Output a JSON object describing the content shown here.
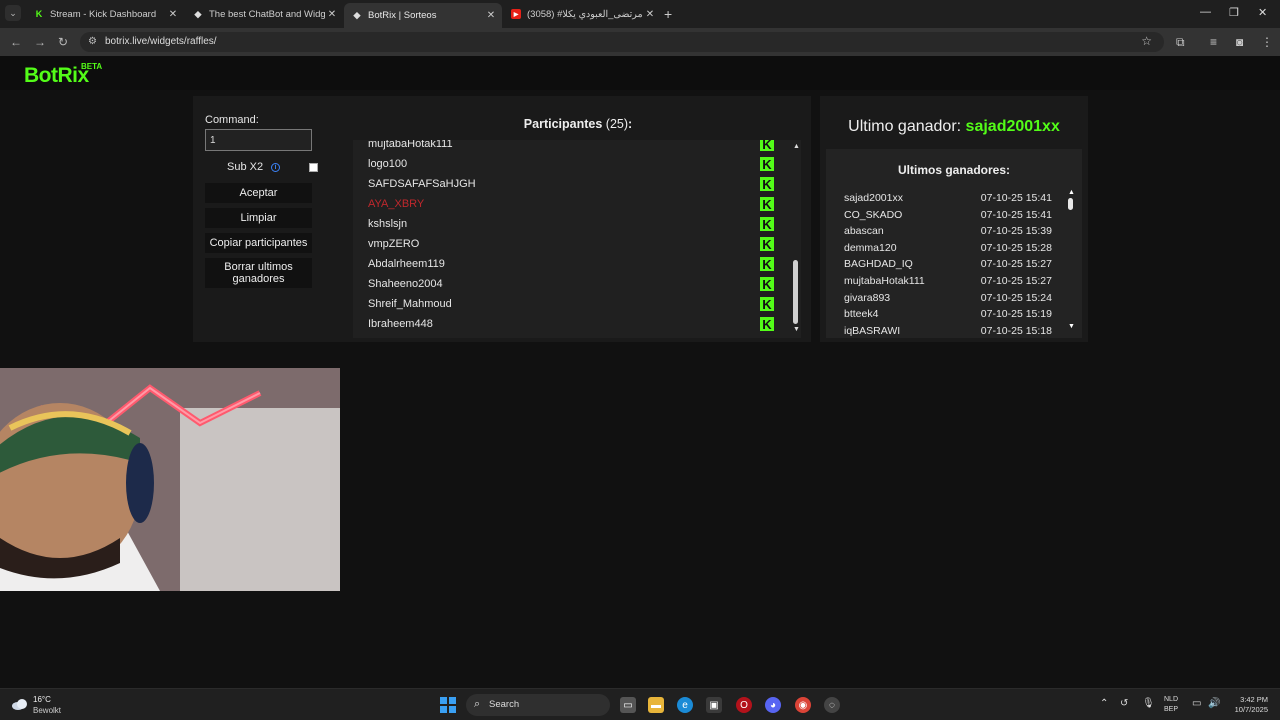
{
  "browser": {
    "tabs": [
      {
        "title": "Stream - Kick Dashboard",
        "favicon": "kick-icon"
      },
      {
        "title": "The best ChatBot and Widgets",
        "favicon": "botrix-icon"
      },
      {
        "title": "BotRix | Sorteos",
        "favicon": "botrix-icon"
      },
      {
        "title": "(3058) #مرتضى_العبودي يكلا...",
        "favicon": "youtube-icon"
      }
    ],
    "url": "botrix.live/widgets/raffles/"
  },
  "site": {
    "logo": "BotRix",
    "beta": "BETA"
  },
  "controls": {
    "command_label": "Command:",
    "command_value": "1",
    "sub_label": "Sub X2",
    "accept": "Aceptar",
    "clear": "Limpiar",
    "copy": "Copiar participantes",
    "delete_winners": "Borrar ultimos ganadores"
  },
  "participants": {
    "title": "Participantes",
    "count": "(25)",
    "suffix": ":",
    "list": [
      {
        "name": "mujtabaHotak111",
        "highlight": false
      },
      {
        "name": "logo100",
        "highlight": false
      },
      {
        "name": "SAFDSAFAFSaHJGH",
        "highlight": false
      },
      {
        "name": "AYA_XBRY",
        "highlight": true
      },
      {
        "name": "kshslsjn",
        "highlight": false
      },
      {
        "name": "vmpZERO",
        "highlight": false
      },
      {
        "name": "Abdalrheem119",
        "highlight": false
      },
      {
        "name": "Shaheeno2004",
        "highlight": false
      },
      {
        "name": "Shreif_Mahmoud",
        "highlight": false
      },
      {
        "name": "Ibraheem448",
        "highlight": false
      }
    ],
    "platform_badge": "K"
  },
  "winners": {
    "last_label": "Ultimo ganador:",
    "last_name": "sajad2001xx",
    "list_title": "Ultimos ganadores:",
    "list": [
      {
        "name": "sajad2001xx",
        "time": "07-10-25 15:41"
      },
      {
        "name": "CO_SKADO",
        "time": "07-10-25 15:41"
      },
      {
        "name": "abascan",
        "time": "07-10-25 15:39"
      },
      {
        "name": "demma120",
        "time": "07-10-25 15:28"
      },
      {
        "name": "BAGHDAD_IQ",
        "time": "07-10-25 15:27"
      },
      {
        "name": "mujtabaHotak111",
        "time": "07-10-25 15:27"
      },
      {
        "name": "givara893",
        "time": "07-10-25 15:24"
      },
      {
        "name": "btteek4",
        "time": "07-10-25 15:19"
      },
      {
        "name": "iqBASRAWI",
        "time": "07-10-25 15:18"
      }
    ]
  },
  "taskbar": {
    "weather_temp": "16°C",
    "weather_desc": "Bewolkt",
    "search": "Search",
    "lang_top": "NLD",
    "lang_bottom": "BEP",
    "time": "3:42 PM",
    "date": "10/7/2025"
  },
  "colors": {
    "brand_green": "#53fc18",
    "highlight_red": "#c0282d",
    "info_blue": "#3b82f6"
  }
}
